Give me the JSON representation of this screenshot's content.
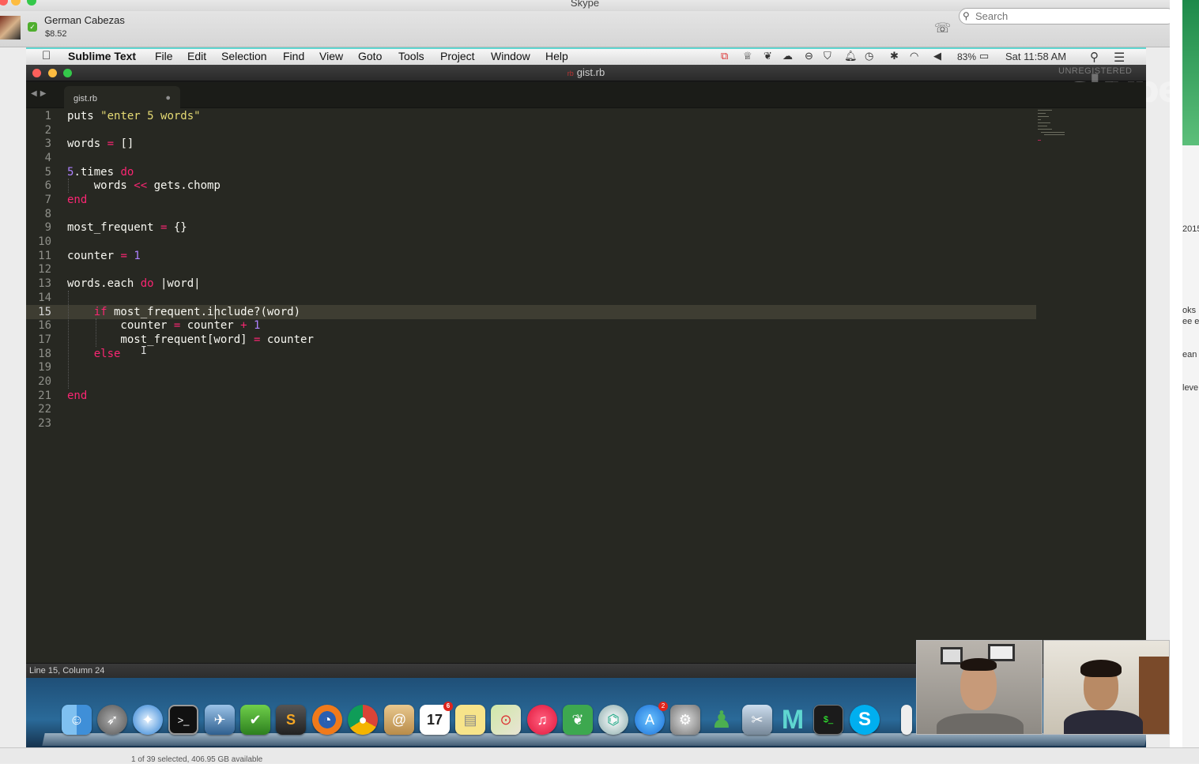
{
  "skype": {
    "window_title": "Skype",
    "contact_name": "German Cabezas",
    "credit": "$8.52",
    "search_placeholder": "Search",
    "watermark": "skype"
  },
  "menubar": {
    "app_name": "Sublime Text",
    "items": [
      "File",
      "Edit",
      "Selection",
      "Find",
      "View",
      "Goto",
      "Tools",
      "Project",
      "Window",
      "Help"
    ],
    "battery": "83%",
    "clock": "Sat 11:58 AM"
  },
  "editor_window": {
    "title": "gist.rb",
    "unregistered": "UNREGISTERED",
    "tab_label": "gist.rb",
    "status": "Line 15, Column 24"
  },
  "code": {
    "line_numbers": [
      "1",
      "2",
      "3",
      "4",
      "5",
      "6",
      "7",
      "8",
      "9",
      "10",
      "11",
      "12",
      "13",
      "14",
      "15",
      "16",
      "17",
      "18",
      "19",
      "20",
      "21",
      "22",
      "23"
    ],
    "active_line": 15,
    "l1": {
      "a": "puts ",
      "b": "\"enter 5 words\""
    },
    "l3": {
      "a": "words ",
      "b": "=",
      "c": " []"
    },
    "l5": {
      "a": "5",
      "b": ".times ",
      "c": "do"
    },
    "l6": {
      "a": "    words ",
      "b": "<<",
      "c": " gets.chomp"
    },
    "l7": {
      "a": "end"
    },
    "l9": {
      "a": "most_frequent ",
      "b": "=",
      "c": " {}"
    },
    "l11": {
      "a": "counter ",
      "b": "=",
      "c": " ",
      "d": "1"
    },
    "l13": {
      "a": "words.each ",
      "b": "do",
      "c": " |word|"
    },
    "l15": {
      "a": "    ",
      "b": "if",
      "c": " most_frequent.include?(word)"
    },
    "l16": {
      "a": "        counter ",
      "b": "=",
      "c": " counter ",
      "d": "+",
      "e": " ",
      "f": "1"
    },
    "l17": {
      "a": "        most_frequent[word] ",
      "b": "=",
      "c": " counter"
    },
    "l18": {
      "a": "    ",
      "b": "else"
    },
    "l21": {
      "a": "end"
    }
  },
  "finder": {
    "status": "1 of 39 selected, 406.95 GB available"
  },
  "dock": {
    "calendar_day": "17",
    "calendar_badge": "6",
    "appstore_badge": "2"
  },
  "background_fragments": [
    "2015",
    "oks",
    "ee e",
    "ean",
    "leve"
  ],
  "colors": {
    "editor_bg": "#272822",
    "keyword": "#f92672",
    "string": "#e6db74",
    "number": "#ae81ff",
    "text": "#f8f8f2",
    "line_number": "#8f908a"
  }
}
